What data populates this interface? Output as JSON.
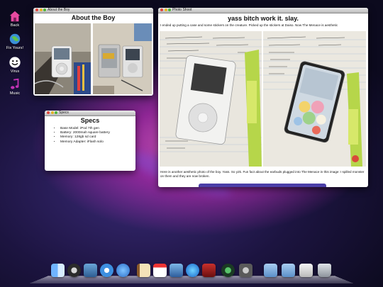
{
  "desktop_icons": [
    {
      "label": "Back",
      "icon": "house-icon"
    },
    {
      "label": "Fix Yours!",
      "icon": "globe-icon"
    },
    {
      "label": "Virus",
      "icon": "smiley-icon"
    },
    {
      "label": "Music",
      "icon": "music-note-icon"
    }
  ],
  "window_about": {
    "titlebar": "About the Boy",
    "heading": "About the Boy"
  },
  "window_specs": {
    "titlebar": "Specs",
    "heading": "Specs",
    "items": [
      "Base Model: iPod 7th gen",
      "Battery: 2000mah square battery",
      "Memory: 128gb sd card",
      "Memory Adapter: iFlash solo"
    ]
  },
  "window_photo": {
    "titlebar": "Photo Shoot",
    "heading": "yass bitch work it. slay.",
    "intro": "I ended up putting a case and some stickers on the creature. Picked up the stickers at Daiso. Now The Menace is aesthetic",
    "caption": "Here is another aesthetic photo of the boy. Yass. So y2k. Fun fact about the earbuds plugged into The Menace in this image: I spilled monster on them and they are now broken."
  },
  "dock": [
    "finder-icon",
    "ipod-icon",
    "preview-icon",
    "safari-icon",
    "ichat-icon",
    "address-book-icon",
    "ical-icon",
    "iphoto-icon",
    "itunes-icon",
    "photo-booth-icon",
    "time-machine-icon",
    "system-preferences-icon",
    "applications-folder-icon",
    "documents-folder-icon",
    "downloads-stack-icon",
    "trash-icon"
  ],
  "colors": {
    "accent_purple": "#4b3fa8",
    "window_bg": "#ffffff"
  }
}
